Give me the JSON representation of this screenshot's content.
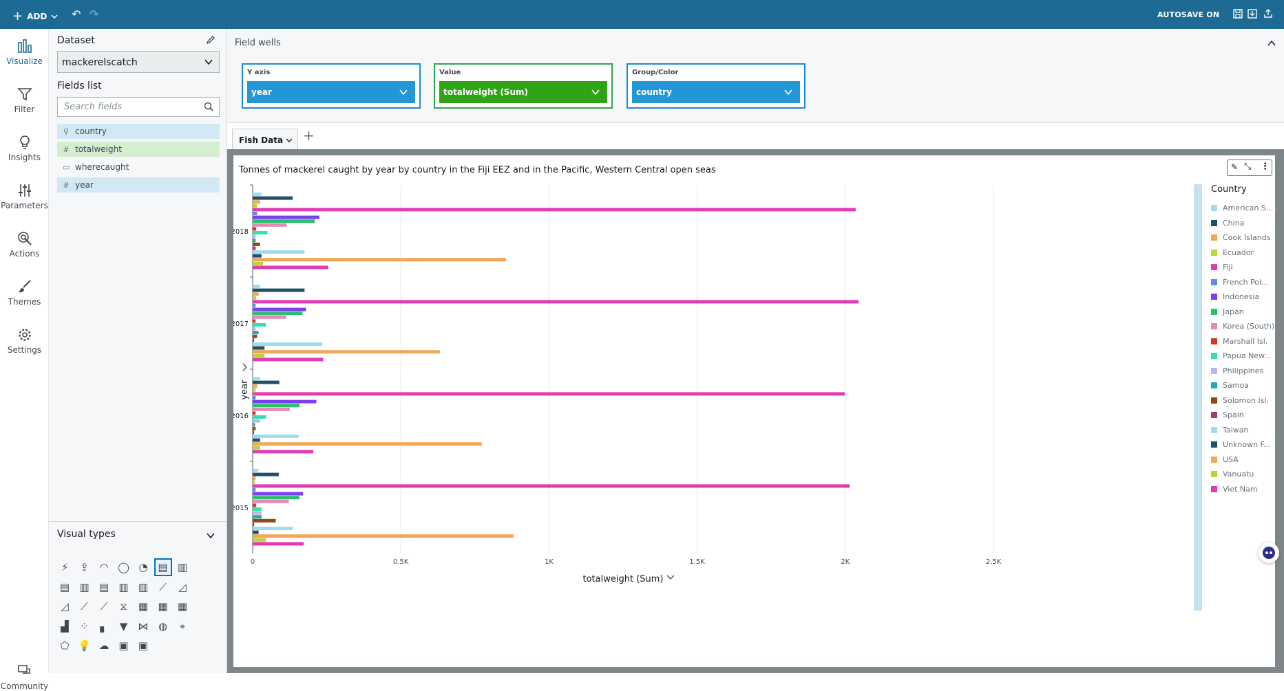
{
  "topbar": {
    "add_label": "ADD",
    "autosave_label": "AUTOSAVE ON",
    "background": "#1d6b95"
  },
  "leftnav": {
    "items": [
      {
        "label": "Visualize",
        "icon": "bar-chart-icon"
      },
      {
        "label": "Filter",
        "icon": "filter-icon"
      },
      {
        "label": "Insights",
        "icon": "lightbulb-icon"
      },
      {
        "label": "Parameters",
        "icon": "sliders-icon"
      },
      {
        "label": "Actions",
        "icon": "cursor-click-icon"
      },
      {
        "label": "Themes",
        "icon": "brush-icon"
      },
      {
        "label": "Settings",
        "icon": "gear-icon"
      }
    ],
    "community_label": "Community"
  },
  "dataset": {
    "heading": "Dataset",
    "value": "mackerelscatch"
  },
  "fields": {
    "heading": "Fields list",
    "search_placeholder": "Search fields",
    "items": [
      {
        "name": "country",
        "icon": "geo-pin-icon",
        "state": "dimension-selected"
      },
      {
        "name": "totalweight",
        "icon": "hash-icon",
        "state": "measure-selected"
      },
      {
        "name": "wherecaught",
        "icon": "text-field-icon",
        "state": "none"
      },
      {
        "name": "year",
        "icon": "hash-icon",
        "state": "dimension-selected"
      }
    ]
  },
  "visual_types": {
    "heading": "Visual types"
  },
  "field_wells": {
    "heading": "Field wells",
    "wells": [
      {
        "label": "Y axis",
        "value": "year"
      },
      {
        "label": "Value",
        "value": "totalweight (Sum)"
      },
      {
        "label": "Group/Color",
        "value": "country"
      }
    ]
  },
  "sheet": {
    "tab_label": "Fish Data"
  },
  "chart_data": {
    "type": "bar",
    "orientation": "horizontal",
    "title": "Tonnes of mackerel caught by year by country in the Fiji EEZ and in the Pacific, Western Central open seas",
    "xlabel": "totalweight (Sum)",
    "ylabel": "year",
    "xlim": [
      0,
      2500
    ],
    "x_ticks": [
      "0",
      "0.5K",
      "1K",
      "1.5K",
      "2K",
      "2.5K"
    ],
    "categories": [
      "2018",
      "2017",
      "2016",
      "2015"
    ],
    "legend_title": "Country",
    "legend_position": "right",
    "series": [
      {
        "name": "American S...",
        "color": "#a6dcf2",
        "values": [
          30,
          25,
          25,
          20
        ]
      },
      {
        "name": "China",
        "color": "#1f5068",
        "values": [
          135,
          175,
          90,
          88
        ]
      },
      {
        "name": "Cook Islands",
        "color": "#f2a65a",
        "values": [
          25,
          20,
          15,
          10
        ]
      },
      {
        "name": "Ecuador",
        "color": "#b9d535",
        "values": [
          15,
          12,
          10,
          8
        ]
      },
      {
        "name": "Fiji",
        "color": "#e03cb4",
        "values": [
          2035,
          2045,
          1998,
          2015
        ]
      },
      {
        "name": "French Pol...",
        "color": "#5e8ddb",
        "values": [
          15,
          10,
          10,
          10
        ]
      },
      {
        "name": "Indonesia",
        "color": "#7b3ff0",
        "values": [
          225,
          180,
          215,
          170
        ]
      },
      {
        "name": "Japan",
        "color": "#2dbf6e",
        "values": [
          210,
          168,
          158,
          158
        ]
      },
      {
        "name": "Korea (South)",
        "color": "#e58ab8",
        "values": [
          115,
          112,
          125,
          122
        ]
      },
      {
        "name": "Marshall Isl.",
        "color": "#d7361f",
        "values": [
          12,
          10,
          10,
          12
        ]
      },
      {
        "name": "Papua New...",
        "color": "#32e0b0",
        "values": [
          50,
          45,
          45,
          30
        ]
      },
      {
        "name": "Philippines",
        "color": "#b7b9e8",
        "values": [
          10,
          10,
          25,
          30
        ]
      },
      {
        "name": "Samoa",
        "color": "#2aa7a7",
        "values": [
          10,
          20,
          8,
          30
        ]
      },
      {
        "name": "Solomon Isl.",
        "color": "#8c4b13",
        "values": [
          25,
          15,
          10,
          78
        ]
      },
      {
        "name": "Spain",
        "color": "#a33d6b",
        "values": [
          10,
          5,
          5,
          5
        ]
      },
      {
        "name": "Taiwan",
        "color": "#9fdcf0",
        "values": [
          175,
          235,
          155,
          135
        ]
      },
      {
        "name": "Unknown F...",
        "color": "#1f5068",
        "values": [
          30,
          40,
          25,
          20
        ]
      },
      {
        "name": "USA",
        "color": "#f2a65a",
        "values": [
          855,
          632,
          773,
          880
        ]
      },
      {
        "name": "Vanuatu",
        "color": "#b9d535",
        "values": [
          35,
          40,
          25,
          45
        ]
      },
      {
        "name": "Viet Nam",
        "color": "#e03cb4",
        "values": [
          255,
          238,
          205,
          172
        ]
      }
    ]
  }
}
